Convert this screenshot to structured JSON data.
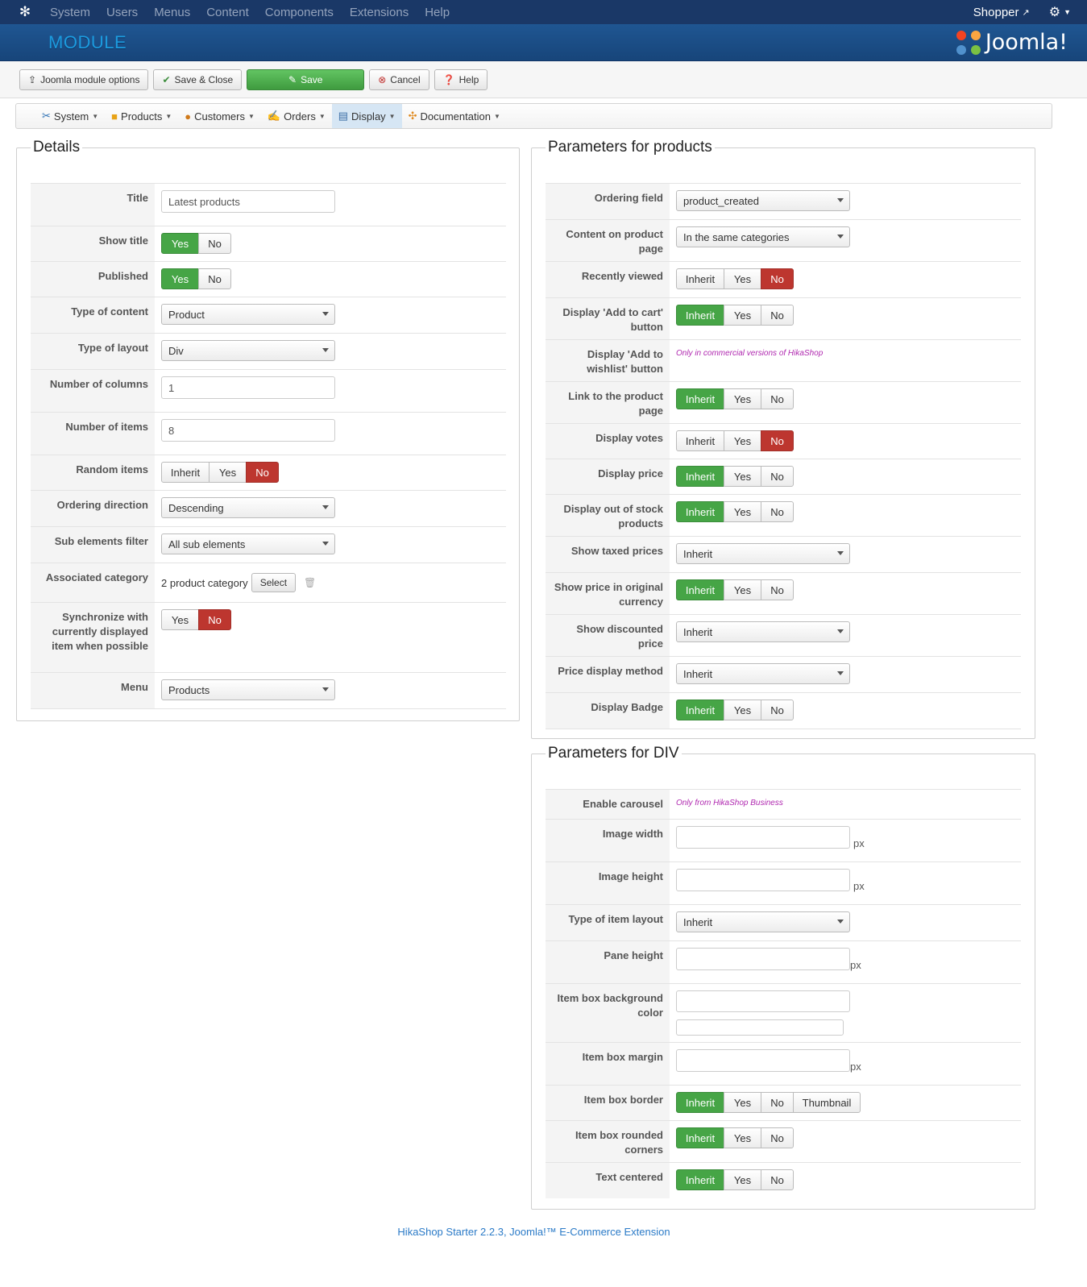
{
  "topbar": {
    "menu": [
      "System",
      "Users",
      "Menus",
      "Content",
      "Components",
      "Extensions",
      "Help"
    ],
    "user": "Shopper"
  },
  "header": {
    "title": "MODULE",
    "brand": "Joomla!"
  },
  "toolbar": {
    "options_label": "Joomla module options",
    "save_close_label": "Save & Close",
    "save_label": "Save",
    "cancel_label": "Cancel",
    "help_label": "Help"
  },
  "hikamenu": [
    "System",
    "Products",
    "Customers",
    "Orders",
    "Display",
    "Documentation"
  ],
  "details": {
    "legend": "Details",
    "title_label": "Title",
    "title_value": "Latest products",
    "show_title_label": "Show title",
    "published_label": "Published",
    "type_content_label": "Type of content",
    "type_content_value": "Product",
    "type_layout_label": "Type of layout",
    "type_layout_value": "Div",
    "columns_label": "Number of columns",
    "columns_value": "1",
    "items_label": "Number of items",
    "items_value": "8",
    "random_label": "Random items",
    "ordering_dir_label": "Ordering direction",
    "ordering_dir_value": "Descending",
    "sub_filter_label": "Sub elements filter",
    "sub_filter_value": "All sub elements",
    "assoc_cat_label": "Associated category",
    "assoc_cat_value": "2 product category",
    "select_label": "Select",
    "sync_label": "Synchronize with currently displayed item when possible",
    "menu_label": "Menu",
    "menu_value": "Products"
  },
  "buttons": {
    "inherit": "Inherit",
    "yes": "Yes",
    "no": "No",
    "thumbnail": "Thumbnail"
  },
  "products": {
    "legend": "Parameters for products",
    "ordering_field_label": "Ordering field",
    "ordering_field_value": "product_created",
    "content_page_label": "Content on product page",
    "content_page_value": "In the same categories",
    "recently_viewed_label": "Recently viewed",
    "add_cart_label": "Display 'Add to cart' button",
    "wishlist_label": "Display 'Add to wishlist' button",
    "wishlist_note": "Only in commercial versions of HikaShop",
    "link_page_label": "Link to the product page",
    "votes_label": "Display votes",
    "price_label": "Display price",
    "out_stock_label": "Display out of stock products",
    "taxed_label": "Show taxed prices",
    "taxed_value": "Inherit",
    "orig_currency_label": "Show price in original currency",
    "discounted_label": "Show discounted price",
    "discounted_value": "Inherit",
    "price_method_label": "Price display method",
    "price_method_value": "Inherit",
    "badge_label": "Display Badge"
  },
  "div": {
    "legend": "Parameters for DIV",
    "carousel_label": "Enable carousel",
    "carousel_note": "Only from HikaShop Business",
    "img_width_label": "Image width",
    "img_height_label": "Image height",
    "item_layout_label": "Type of item layout",
    "item_layout_value": "Inherit",
    "pane_height_label": "Pane height",
    "bg_color_label": "Item box background color",
    "margin_label": "Item box margin",
    "border_label": "Item box border",
    "rounded_label": "Item box rounded corners",
    "centered_label": "Text centered",
    "px": "px"
  },
  "footer": "HikaShop Starter 2.2.3, Joomla!™ E-Commerce Extension"
}
